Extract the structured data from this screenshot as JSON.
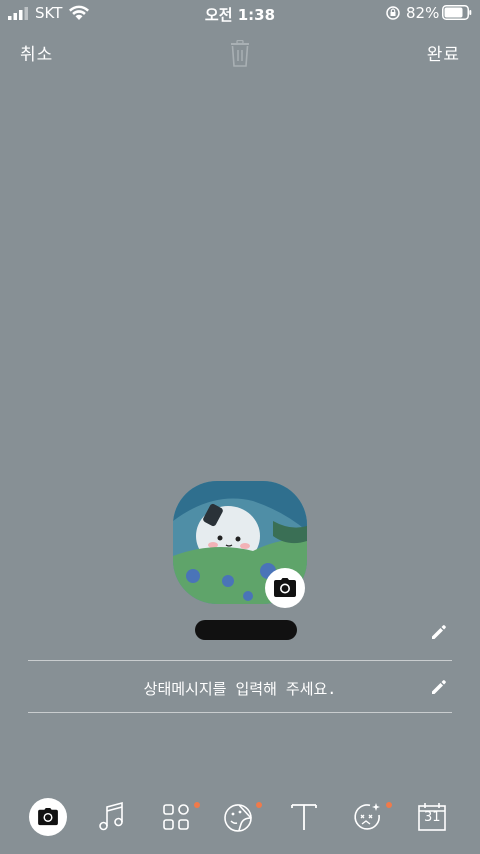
{
  "status_bar": {
    "carrier": "SKT",
    "time": "오전 1:38",
    "battery_percent": "82%",
    "battery_level": 0.82
  },
  "nav": {
    "cancel_label": "취소",
    "done_label": "완료",
    "trash_icon": "trash-icon"
  },
  "profile": {
    "status_placeholder": "상태메시지를 입력해 주세요."
  },
  "toolbar": {
    "items": [
      "camera-icon",
      "music-note-icon",
      "apps-grid-icon",
      "sticker-icon",
      "text-icon",
      "effects-icon",
      "calendar-icon"
    ],
    "calendar_day": "31"
  },
  "colors": {
    "background": "#879095",
    "notification_dot": "#f07a4a"
  }
}
